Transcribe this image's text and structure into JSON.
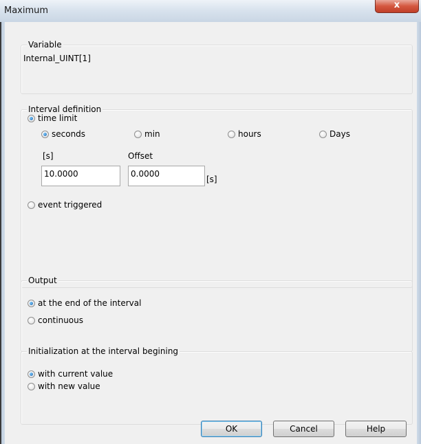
{
  "window": {
    "title": "Maximum",
    "close_label": "x"
  },
  "variable": {
    "group_label": "Variable",
    "value": "Internal_UINT[1]"
  },
  "interval": {
    "group_label": "Interval definition",
    "time_limit_label": "time limit",
    "units": {
      "seconds": "seconds",
      "min": "min",
      "hours": "hours",
      "days": "Days"
    },
    "interval_label": "[s]",
    "interval_value": "10.0000",
    "offset_label": "Offset",
    "offset_value": "0.0000",
    "offset_unit": "[s]",
    "event_triggered_label": "event triggered"
  },
  "output": {
    "group_label": "Output",
    "end_label": "at the end of the interval",
    "continuous_label": "continuous"
  },
  "initialization": {
    "group_label": "Initialization at the interval begining",
    "current_label": "with current value",
    "new_label": "with new value"
  },
  "buttons": {
    "ok": "OK",
    "cancel": "Cancel",
    "help": "Help"
  }
}
